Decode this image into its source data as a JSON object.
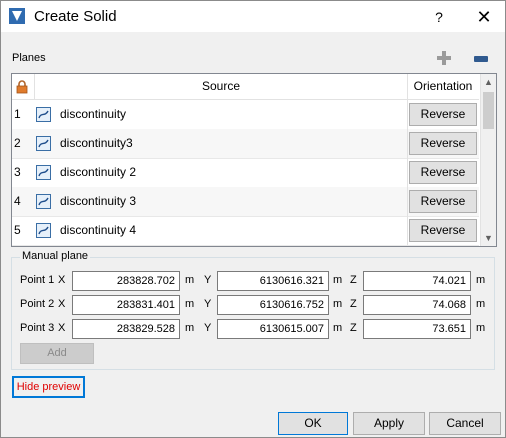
{
  "window": {
    "title": "Create Solid",
    "help_label": "?",
    "close_label": "✕"
  },
  "planes": {
    "label": "Planes",
    "columns": {
      "source": "Source",
      "orientation": "Orientation"
    },
    "rows": [
      {
        "num": "1",
        "source": "discontinuity",
        "action": "Reverse"
      },
      {
        "num": "2",
        "source": "discontinuity3",
        "action": "Reverse"
      },
      {
        "num": "3",
        "source": "discontinuity 2",
        "action": "Reverse"
      },
      {
        "num": "4",
        "source": "discontinuity 3",
        "action": "Reverse"
      },
      {
        "num": "5",
        "source": "discontinuity 4",
        "action": "Reverse"
      }
    ]
  },
  "manual_plane": {
    "title": "Manual plane",
    "axis_labels": {
      "x": "X",
      "y": "Y",
      "z": "Z"
    },
    "unit": "m",
    "points": [
      {
        "label": "Point 1",
        "x": "283828.702",
        "y": "6130616.321",
        "z": "74.021"
      },
      {
        "label": "Point 2",
        "x": "283831.401",
        "y": "6130616.752",
        "z": "74.068"
      },
      {
        "label": "Point 3",
        "x": "283829.528",
        "y": "6130615.007",
        "z": "73.651"
      }
    ],
    "add_label": "Add"
  },
  "hide_preview_label": "Hide preview",
  "footer": {
    "ok": "OK",
    "apply": "Apply",
    "cancel": "Cancel"
  },
  "icons": {
    "app": "app-logo-icon",
    "add_plane": "plus-icon",
    "remove_plane": "minus-icon",
    "lock": "lock-icon",
    "plane": "plane-surface-icon"
  },
  "colors": {
    "accent": "#0078d7",
    "hide_preview_text": "#e00000",
    "app_icon": "#2f6bb0"
  }
}
